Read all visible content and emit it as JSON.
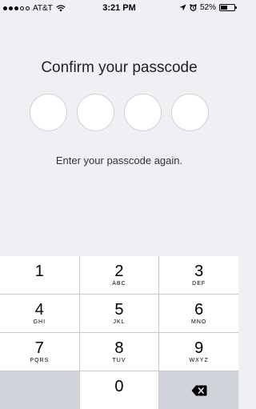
{
  "status_bar": {
    "signal_filled": 3,
    "signal_total": 5,
    "carrier": "AT&T",
    "time": "3:21 PM",
    "battery_percent": "52%",
    "battery_level": 0.52
  },
  "title": "Confirm your passcode",
  "passcode": {
    "length": 4,
    "entered": 0
  },
  "hint": "Enter your passcode again.",
  "keypad": {
    "keys": [
      {
        "digit": "1",
        "letters": ""
      },
      {
        "digit": "2",
        "letters": "ABC"
      },
      {
        "digit": "3",
        "letters": "DEF"
      },
      {
        "digit": "4",
        "letters": "GHI"
      },
      {
        "digit": "5",
        "letters": "JKL"
      },
      {
        "digit": "6",
        "letters": "MNO"
      },
      {
        "digit": "7",
        "letters": "PQRS"
      },
      {
        "digit": "8",
        "letters": "TUV"
      },
      {
        "digit": "9",
        "letters": "WXYZ"
      },
      {
        "digit": "0",
        "letters": ""
      }
    ],
    "delete_icon": "backspace-icon"
  },
  "colors": {
    "background": "#efeff4",
    "keypad_bg": "#d1d4db",
    "dot_fill": "#ffffff"
  }
}
